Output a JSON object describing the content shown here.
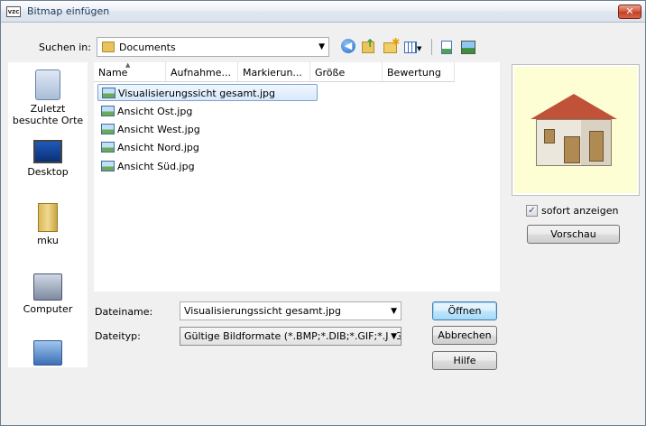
{
  "window": {
    "title": "Bitmap einfügen",
    "app_icon_text": "vzc",
    "close_glyph": "✕"
  },
  "lookin": {
    "label": "Suchen in:",
    "value": "Documents"
  },
  "places": [
    {
      "label": "Zuletzt besuchte Orte"
    },
    {
      "label": "Desktop"
    },
    {
      "label": "mku"
    },
    {
      "label": "Computer"
    },
    {
      "label": ""
    }
  ],
  "columns": [
    "Name",
    "Aufnahme...",
    "Markierun...",
    "Größe",
    "Bewertung"
  ],
  "files": [
    {
      "name": "Visualisierungssicht gesamt.jpg",
      "selected": true
    },
    {
      "name": "Ansicht Ost.jpg"
    },
    {
      "name": "Ansicht West.jpg"
    },
    {
      "name": "Ansicht Nord.jpg"
    },
    {
      "name": "Ansicht Süd.jpg"
    }
  ],
  "filename": {
    "label": "Dateiname:",
    "value": "Visualisierungssicht gesamt.jpg"
  },
  "filetype": {
    "label": "Dateityp:",
    "value": "Gültige Bildformate (*.BMP;*.DIB;*.GIF;*.JPG;*.J"
  },
  "buttons": {
    "open": "Öffnen",
    "cancel": "Abbrechen",
    "help": "Hilfe",
    "preview": "Vorschau"
  },
  "preview_option": {
    "label": "sofort anzeigen",
    "checked": true,
    "check_glyph": "✓"
  },
  "glyphs": {
    "dropdown": "▼",
    "sort_up": "▲",
    "back": "◀",
    "up": "↑",
    "new": "✱",
    "view_arrow": "▼"
  }
}
